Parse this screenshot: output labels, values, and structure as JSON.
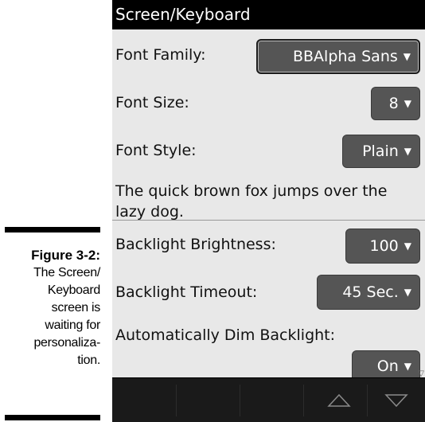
{
  "caption": {
    "figure_number": "Figure 3-2:",
    "lines": [
      "The Screen/",
      "Keyboard",
      "screen is",
      "waiting for",
      "personaliza-",
      "tion."
    ]
  },
  "screen": {
    "title": "Screen/Keyboard",
    "font_family": {
      "label": "Font Family:",
      "value": "BBAlpha Sans"
    },
    "font_size": {
      "label": "Font Size:",
      "value": "8"
    },
    "font_style": {
      "label": "Font Style:",
      "value": "Plain"
    },
    "sample_text": "The quick brown fox jumps over the lazy dog.",
    "backlight_brightness": {
      "label": "Backlight Brightness:",
      "value": "100"
    },
    "backlight_timeout": {
      "label": "Backlight Timeout:",
      "value": "45 Sec."
    },
    "auto_dim": {
      "label": "Automatically Dim Backlight:",
      "value": "On"
    },
    "dropdown_arrow": "▼",
    "scroll_indicator": "▽"
  },
  "nav": {
    "up_icon": "triangle-up-outline",
    "down_icon": "triangle-down-outline"
  }
}
